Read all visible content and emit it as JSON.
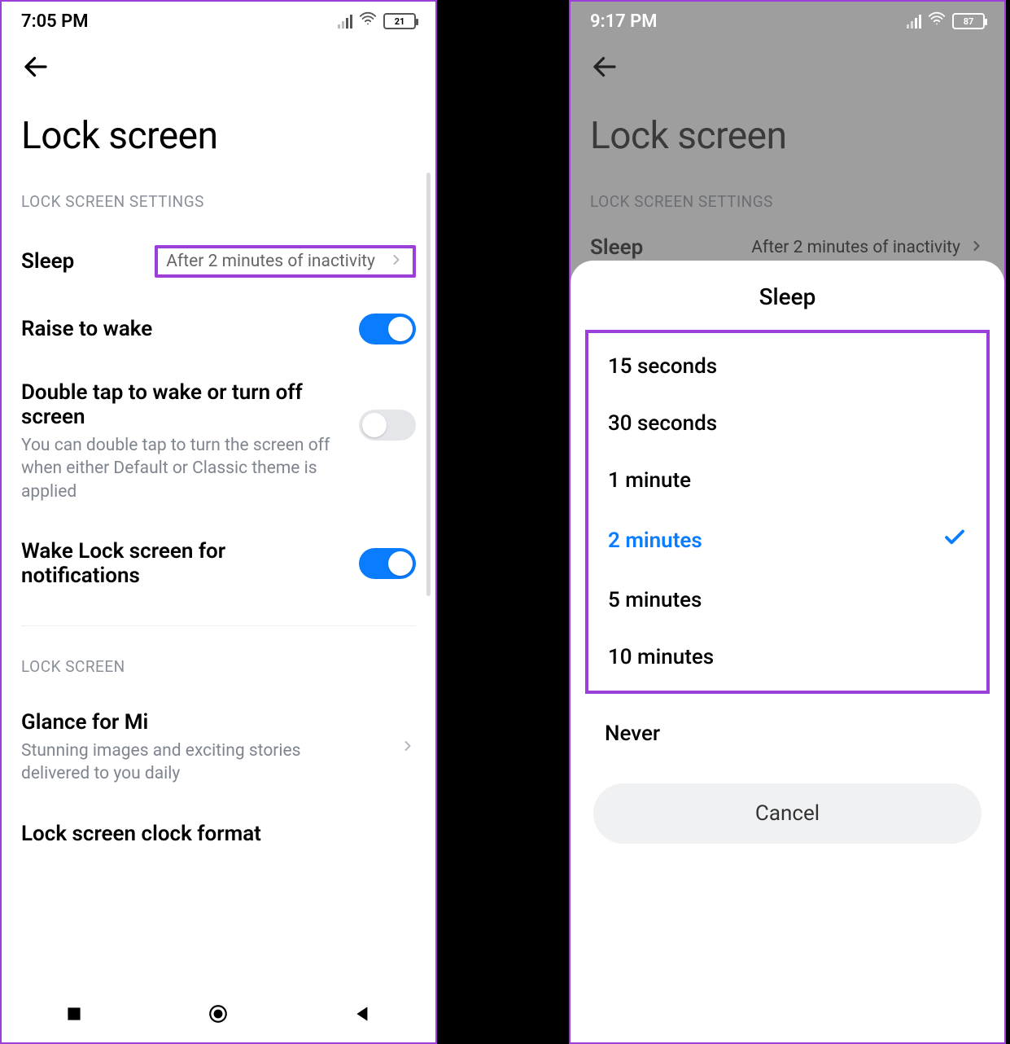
{
  "left": {
    "status": {
      "time": "7:05 PM",
      "battery": "21"
    },
    "page_title": "Lock screen",
    "section1_label": "LOCK SCREEN SETTINGS",
    "sleep": {
      "label": "Sleep",
      "value": "After 2 minutes of inactivity"
    },
    "raise": {
      "label": "Raise to wake",
      "on": true
    },
    "dtap": {
      "label": "Double tap to wake or turn off screen",
      "sub": "You can double tap to turn the screen off when either Default or Classic theme is applied",
      "on": false
    },
    "wakelock": {
      "label": "Wake Lock screen for notifications",
      "on": true
    },
    "section2_label": "LOCK SCREEN",
    "glance": {
      "label": "Glance for Mi",
      "sub": "Stunning images and exciting stories delivered to you daily"
    },
    "clockfmt": {
      "label": "Lock screen clock format"
    }
  },
  "right": {
    "status": {
      "time": "9:17 PM",
      "battery": "87"
    },
    "page_title": "Lock screen",
    "section1_label": "LOCK SCREEN SETTINGS",
    "sleep": {
      "label": "Sleep",
      "value": "After 2 minutes of inactivity"
    },
    "sheet": {
      "title": "Sleep",
      "options": [
        "15 seconds",
        "30 seconds",
        "1 minute",
        "2 minutes",
        "5 minutes",
        "10 minutes"
      ],
      "selected_index": 3,
      "never_label": "Never",
      "cancel_label": "Cancel"
    }
  }
}
